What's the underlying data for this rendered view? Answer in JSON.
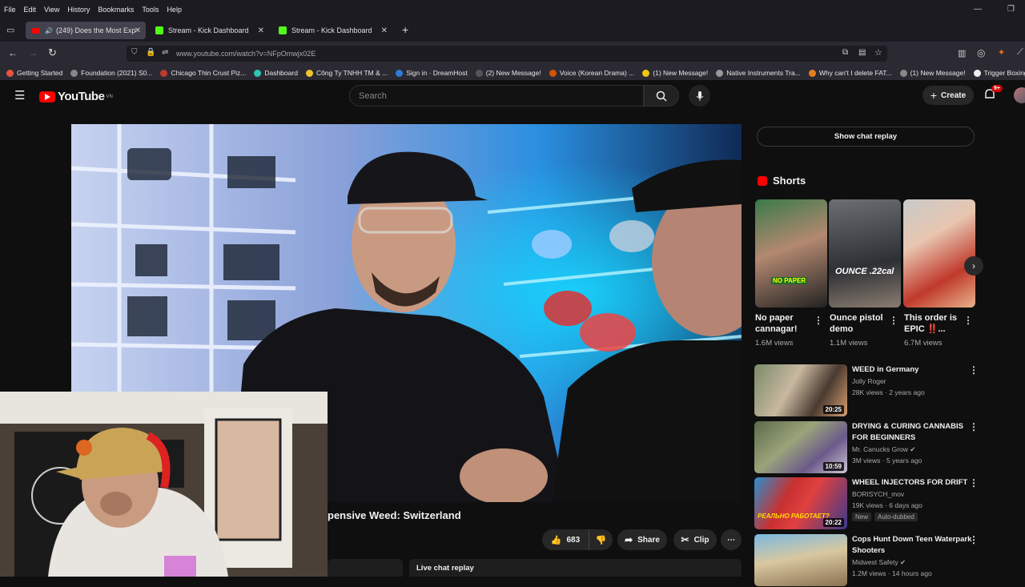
{
  "menu": [
    "File",
    "Edit",
    "View",
    "History",
    "Bookmarks",
    "Tools",
    "Help"
  ],
  "tabs": [
    {
      "label": "(249) Does the Most Expen"
    },
    {
      "label": "Stream - Kick Dashboard"
    },
    {
      "label": "Stream - Kick Dashboard"
    }
  ],
  "url": "www.youtube.com/watch?v=NFpOmwjx02E",
  "bookmarks": [
    {
      "label": "Getting Started",
      "color": "#e8543e"
    },
    {
      "label": "Foundation (2021) S0...",
      "color": "#888"
    },
    {
      "label": "Chicago Thin Crust Piz...",
      "color": "#c0392b"
    },
    {
      "label": "Dashboard",
      "color": "#2ec4b6"
    },
    {
      "label": "Công Ty TNHH TM & ...",
      "color": "#f0c330"
    },
    {
      "label": "Sign in · DreamHost",
      "color": "#2b7bd9"
    },
    {
      "label": "(2) New Message!",
      "color": "#555"
    },
    {
      "label": "Voice (Korean Drama) ...",
      "color": "#d35400"
    },
    {
      "label": "(1) New Message!",
      "color": "#f1c40f"
    },
    {
      "label": "Native Instruments Tra...",
      "color": "#999"
    },
    {
      "label": "Why can't I delete FAT...",
      "color": "#e67e22"
    },
    {
      "label": "(1) New Message!",
      "color": "#888"
    },
    {
      "label": "Trigger Boxing",
      "color": "#eee"
    }
  ],
  "youtube": {
    "logo": "YouTube",
    "region": "VN",
    "search_placeholder": "Search",
    "create_label": "Create",
    "notif_count": "9+"
  },
  "video": {
    "title_visible": "pensive Weed: Switzerland",
    "likes": "683",
    "share_label": "Share",
    "clip_label": "Clip",
    "live_chat_label": "Live chat replay"
  },
  "sidebar": {
    "chat_button": "Show chat replay",
    "shorts_heading": "Shorts",
    "shorts": [
      {
        "title": "No paper cannagar!",
        "views": "1.6M views",
        "overlay": "NO PAPER"
      },
      {
        "title": "Ounce pistol demo",
        "views": "1.1M views",
        "overlay": "OUNCE .22cal"
      },
      {
        "title": "This order is EPIC ‼️...",
        "views": "6.7M views",
        "overlay": ""
      }
    ],
    "recommended": [
      {
        "title": "WEED in Germany",
        "channel": "Jolly Roger",
        "meta": "28K views · 2 years ago",
        "duration": "20:25",
        "tags": []
      },
      {
        "title": "DRYING & CURING CANNABIS FOR BEGINNERS",
        "channel": "Mr. Canucks Grow ✔",
        "meta": "3M views · 5 years ago",
        "duration": "10:59",
        "tags": []
      },
      {
        "title": "WHEEL INJECTORS FOR DRIFT",
        "channel": "BORISYCH_mov",
        "meta": "19K views · 6 days ago",
        "duration": "20:22",
        "tags": [
          "New",
          "Auto-dubbed"
        ]
      },
      {
        "title": "Cops Hunt Down Teen Waterpark Shooters",
        "channel": "Midwest Safety ✔",
        "meta": "1.2M views · 14 hours ago",
        "duration": "",
        "tags": []
      }
    ]
  },
  "colors": {
    "accent": "#ff0000",
    "background": "#0f0f0f",
    "kick": "#53fc18"
  }
}
